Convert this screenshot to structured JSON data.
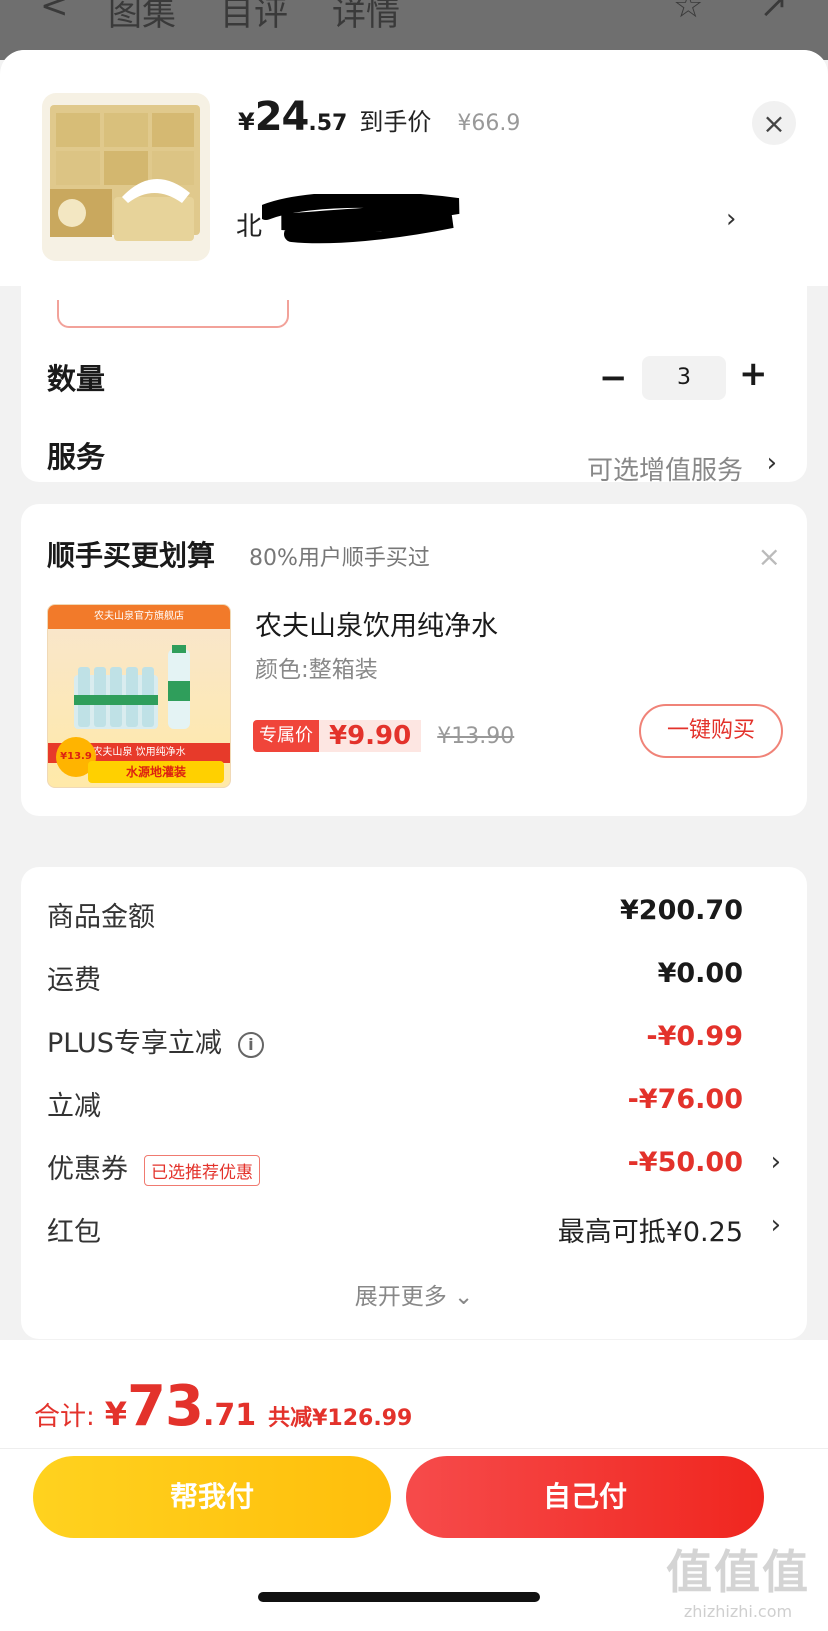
{
  "background_nav": {
    "back_glyph": "<",
    "tabs": [
      "图集",
      "目评",
      "详情"
    ],
    "icons": [
      "star-icon",
      "share-icon"
    ]
  },
  "product": {
    "price_symbol": "¥",
    "price_int": "24",
    "price_dec": ".57",
    "price_tag": "到手价",
    "original_price": "¥66.9",
    "address_prefix": "北",
    "address_chevron": "›",
    "close_glyph": "×"
  },
  "quantity_card": {
    "quantity_label": "数量",
    "minus": "−",
    "quantity_value": "3",
    "plus": "+",
    "service_label": "服务",
    "service_value": "可选增值服务",
    "service_chevron": "›"
  },
  "upsell": {
    "title": "顺手买更划算",
    "subtitle": "80%用户顺手买过",
    "close_glyph": "×",
    "item_name": "农夫山泉饮用纯净水",
    "item_spec": "颜色:整箱装",
    "exclusive_tag": "专属价",
    "exclusive_price": "¥9.90",
    "original_price": "¥13.90",
    "buy_button": "一键购买",
    "image": {
      "store_banner": "农夫山泉官方旗舰店",
      "product_band": "农夫山泉 饮用纯净水",
      "badge": "¥13.9",
      "footer": "水源地灌装"
    }
  },
  "price_breakdown": {
    "rows": [
      {
        "label": "商品金额",
        "value": "¥200.70",
        "red": false
      },
      {
        "label": "运费",
        "value": "¥0.00",
        "red": false
      },
      {
        "label": "PLUS专享立减",
        "value": "-¥0.99",
        "red": true,
        "info_glyph": "i"
      },
      {
        "label": "立减",
        "value": "-¥76.00",
        "red": true
      },
      {
        "label": "优惠券",
        "value": "-¥50.00",
        "red": true,
        "tag": "已选推荐优惠",
        "chevron": "›"
      },
      {
        "label": "红包",
        "value": "最高可抵¥0.25",
        "red": false,
        "chevron": "›"
      }
    ],
    "expand_label": "展开更多 ⌄"
  },
  "footer": {
    "total_label": "合计:",
    "total_symbol": "¥",
    "total_int": "73",
    "total_dec": ".71",
    "total_saved": "共减¥126.99",
    "help_pay_button": "帮我付",
    "self_pay_button": "自己付"
  },
  "watermark": {
    "logo": "值值值",
    "url": "zhizhizhi.com"
  },
  "colors": {
    "accent_red": "#e3322b",
    "help_yellow": "#ffc414",
    "pay_red": "#f23a33"
  }
}
